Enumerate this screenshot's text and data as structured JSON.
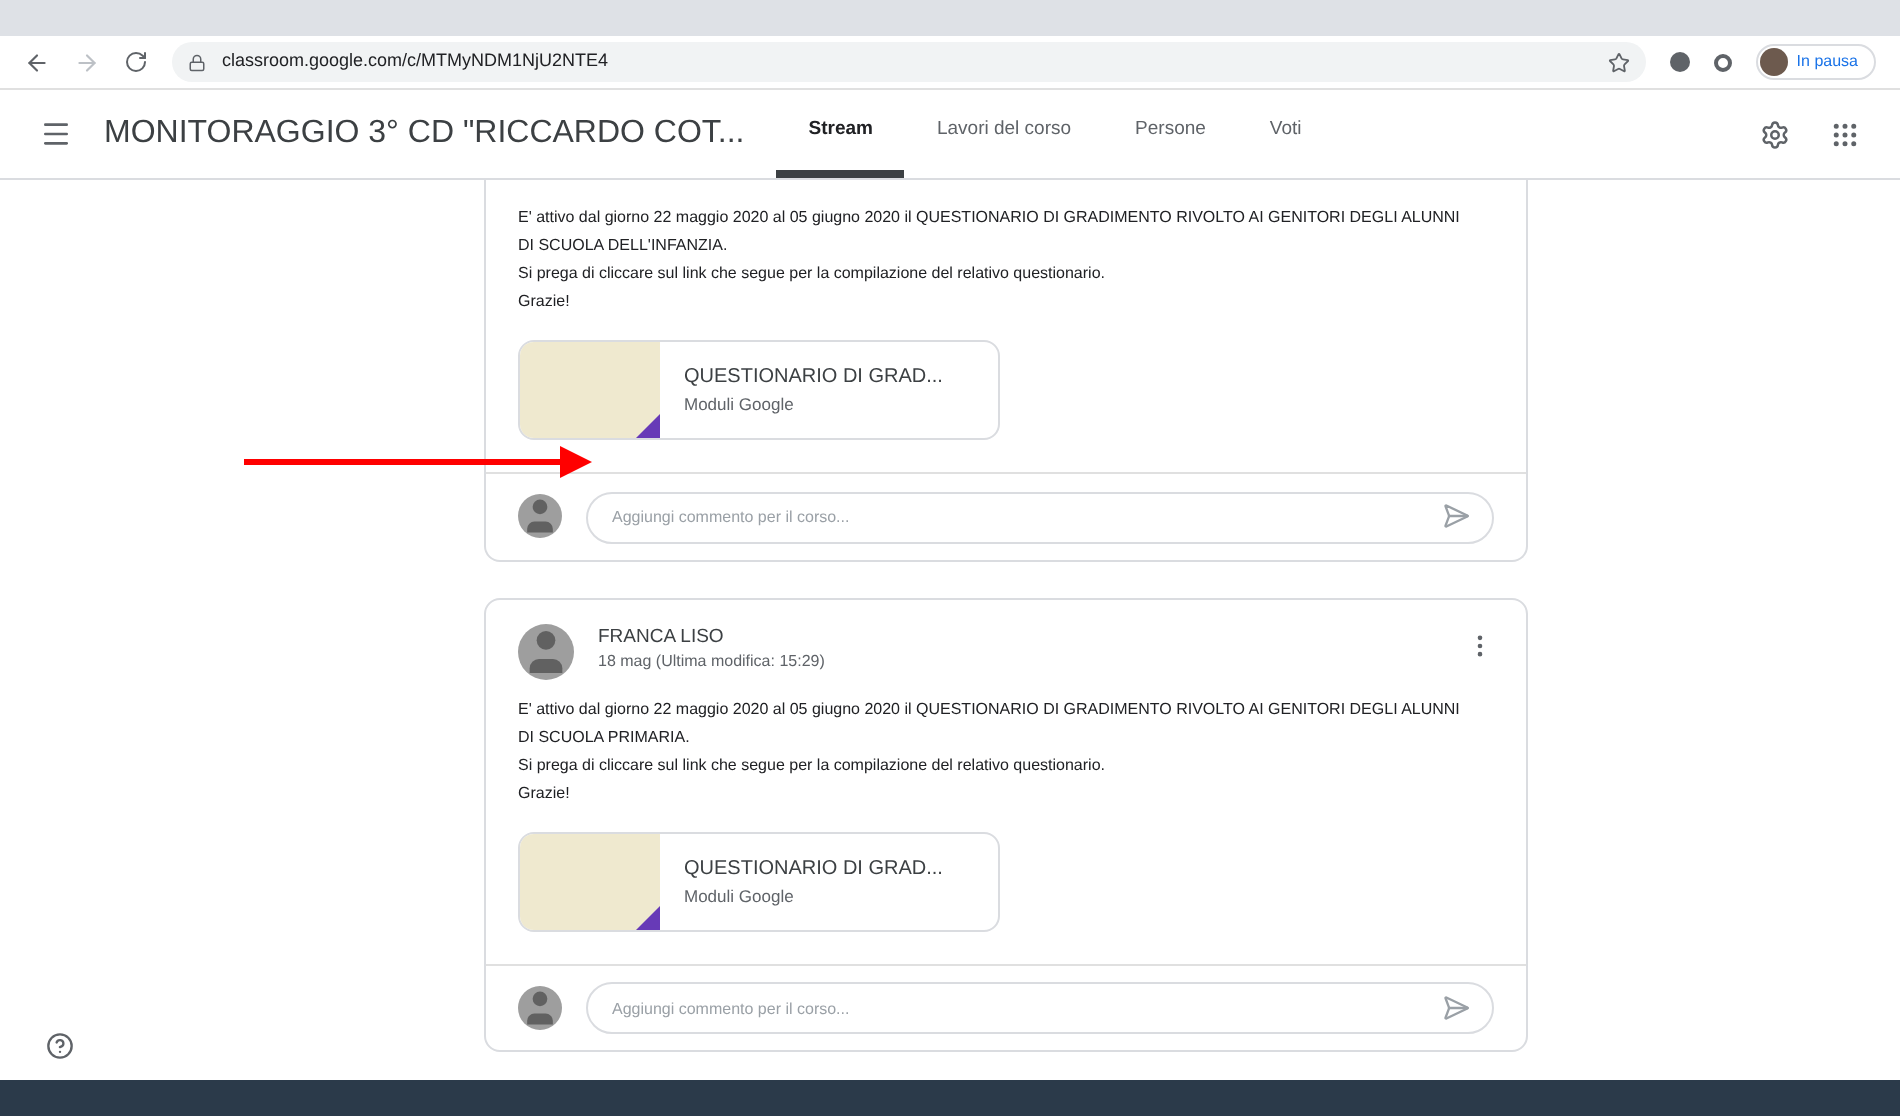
{
  "browser": {
    "url": "classroom.google.com/c/MTMyNDM1NjU2NTE4",
    "profile_label": "In pausa"
  },
  "header": {
    "class_name": "MONITORAGGIO 3° CD \"RICCARDO COT...",
    "tabs": [
      {
        "label": "Stream",
        "selected": true
      },
      {
        "label": "Lavori del corso",
        "selected": false
      },
      {
        "label": "Persone",
        "selected": false
      },
      {
        "label": "Voti",
        "selected": false
      }
    ]
  },
  "posts": [
    {
      "paragraphs": [
        "E' attivo dal giorno 22 maggio 2020 al 05 giugno 2020 il QUESTIONARIO DI GRADIMENTO RIVOLTO AI GENITORI DEGLI ALUNNI DI SCUOLA DELL'INFANZIA.",
        "Si prega di cliccare sul link che segue per la compilazione del relativo questionario.",
        "Grazie!"
      ],
      "attachment": {
        "title": "QUESTIONARIO DI GRAD...",
        "type": "Moduli Google"
      },
      "comment_placeholder": "Aggiungi commento per il corso..."
    },
    {
      "author": "FRANCA LISO",
      "date": "18 mag (Ultima modifica: 15:29)",
      "paragraphs": [
        "E' attivo dal giorno 22 maggio 2020 al 05 giugno 2020 il QUESTIONARIO DI GRADIMENTO RIVOLTO AI GENITORI DEGLI ALUNNI DI SCUOLA PRIMARIA.",
        "Si prega di cliccare sul link che segue per la compilazione del relativo questionario.",
        "Grazie!"
      ],
      "attachment": {
        "title": "QUESTIONARIO DI GRAD...",
        "type": "Moduli Google"
      },
      "comment_placeholder": "Aggiungi commento per il corso..."
    }
  ]
}
